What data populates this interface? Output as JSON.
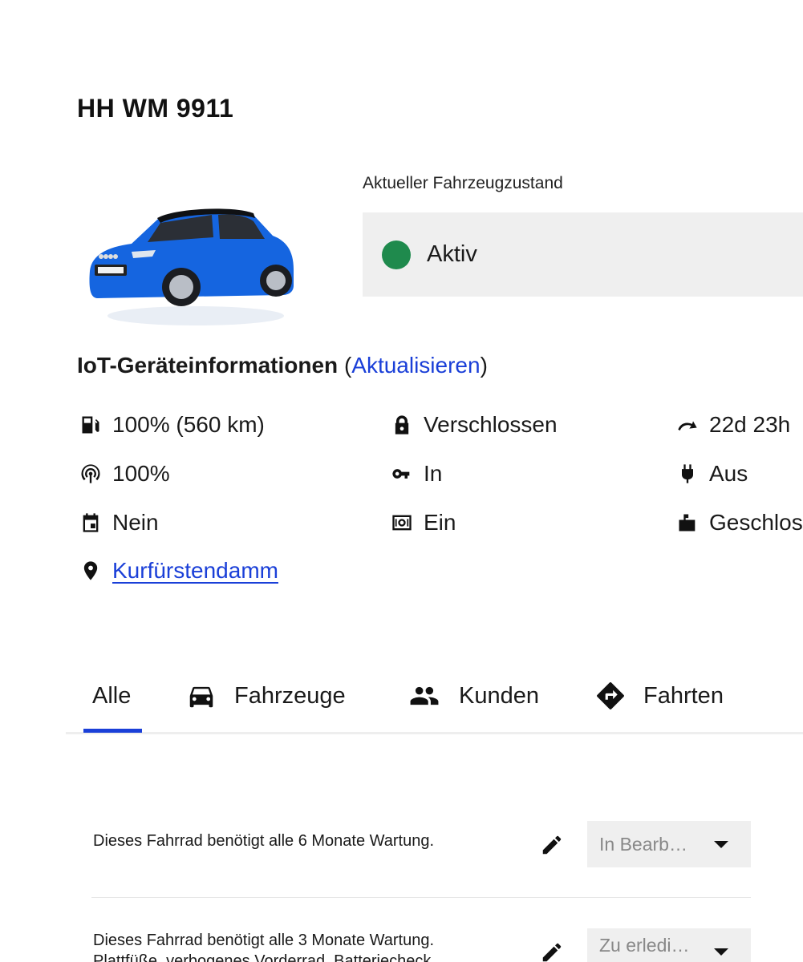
{
  "vehicle": {
    "plate": "HH WM 9911",
    "state_label": "Aktueller Fahrzeugzustand",
    "state_value": "Aktiv",
    "state_color": "#1f8a4d"
  },
  "iot": {
    "title": "IoT-Geräteinformationen",
    "refresh_open": "(",
    "refresh_label": "Aktualisieren",
    "refresh_close": ")",
    "items": {
      "fuel": {
        "icon": "fuel-icon",
        "value": "100% (560 km)"
      },
      "lock": {
        "icon": "lock-icon",
        "value": "Verschlossen"
      },
      "runtime": {
        "icon": "redo-arrow-icon",
        "value": "22d 23h"
      },
      "signal": {
        "icon": "signal-icon",
        "value": "100%"
      },
      "key": {
        "icon": "key-icon",
        "value": "In"
      },
      "charging": {
        "icon": "plug-icon",
        "value": "Aus"
      },
      "calendar": {
        "icon": "calendar-icon",
        "value": "Nein"
      },
      "immobilizer": {
        "icon": "immobilizer-icon",
        "value": "Ein"
      },
      "mailbox": {
        "icon": "mailbox-icon",
        "value": "Geschlos"
      },
      "location": {
        "icon": "location-pin-icon",
        "value": "Kurfürstendamm"
      }
    }
  },
  "tabs": [
    {
      "label": "Alle",
      "icon": ""
    },
    {
      "label": "Fahrzeuge",
      "icon": "car-icon"
    },
    {
      "label": "Kunden",
      "icon": "people-icon"
    },
    {
      "label": "Fahrten",
      "icon": "directions-icon"
    }
  ],
  "tasks": [
    {
      "text": "Dieses Fahrrad benötigt alle 6 Monate Wartung.",
      "status": "In Bearb…"
    },
    {
      "text": "Dieses Fahrrad benötigt alle 3 Monate Wartung.",
      "text2": "Plattfüße, verbogenes Vorderrad, Batteriecheck",
      "status": "Zu erledi…"
    }
  ],
  "colors": {
    "accent": "#1a3fd8",
    "status_green": "#1f8a4d",
    "car_blue": "#1565e0"
  }
}
